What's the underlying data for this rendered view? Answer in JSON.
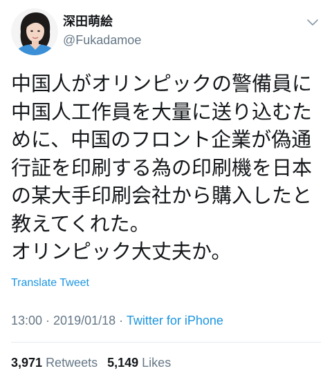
{
  "user": {
    "display_name": "深田萌絵",
    "handle": "@Fukadamoe",
    "avatar_icon": "profile-photo"
  },
  "header": {
    "menu_icon": "chevron-down-icon"
  },
  "tweet": {
    "text": "中国人がオリンピックの警備員に\n中国人工作員を大量に送り込むた\nめに、中国のフロント企業が偽通\n行証を印刷する為の印刷機を日本\nの某大手印刷会社から購入したと\n教えてくれた。\nオリンピック大丈夫か。",
    "translate_label": "Translate Tweet"
  },
  "meta": {
    "time": "13:00",
    "separator1": " · ",
    "date": "2019/01/18",
    "separator2": " · ",
    "source": "Twitter for iPhone"
  },
  "stats": {
    "retweets_count": "3,971",
    "retweets_label": "Retweets",
    "likes_count": "5,149",
    "likes_label": "Likes"
  },
  "colors": {
    "link": "#1b95e0",
    "secondary_text": "#657786",
    "primary_text": "#14171a",
    "divider": "#e6ecf0"
  }
}
